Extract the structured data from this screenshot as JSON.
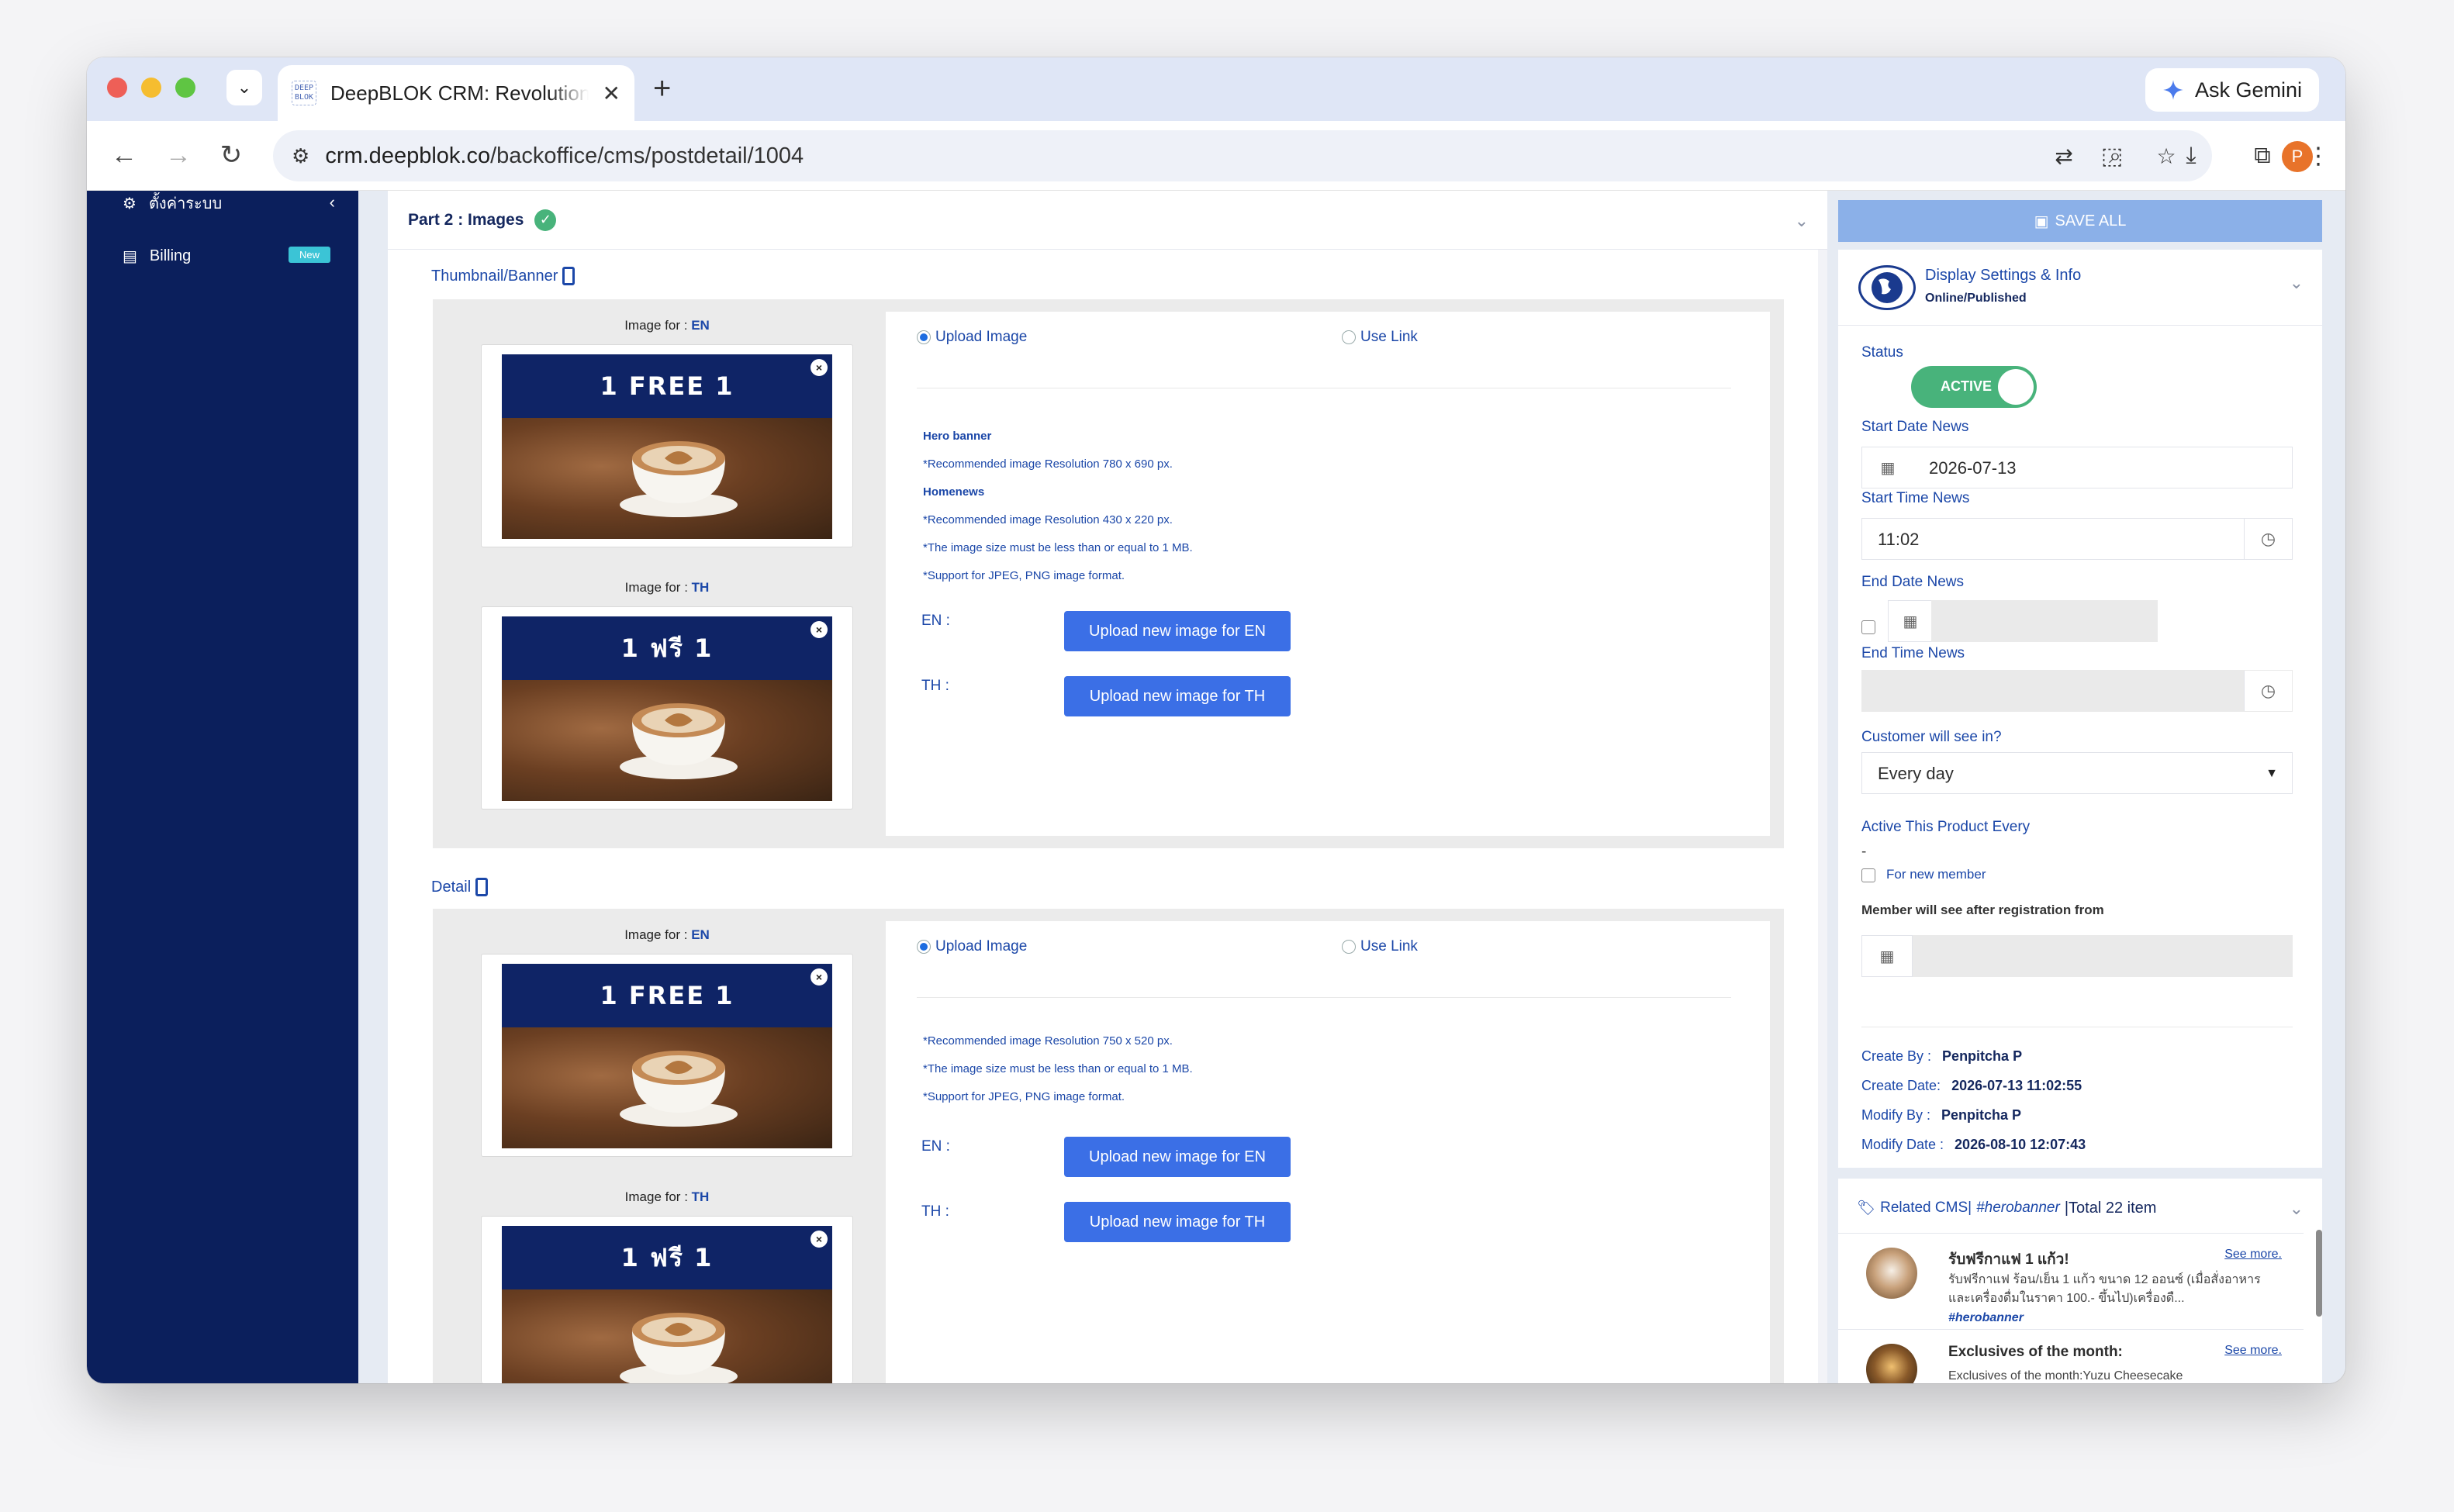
{
  "browser": {
    "tab_title": "DeepBLOK CRM: Revolutionize",
    "tab_favicon_text": "DEEP BLOK",
    "ask_gemini": "Ask Gemini",
    "url_host": "crm.deepblok.co",
    "url_path": "/backoffice/cms/postdetail/1004",
    "profile_initial": "P"
  },
  "sidebar": {
    "settings_label": "ตั้งค่าระบบ",
    "billing_label": "Billing",
    "billing_badge": "New"
  },
  "part2": {
    "title": "Part 2 : Images"
  },
  "thumbnail": {
    "section_label": "Thumbnail/Banner",
    "image_for_prefix": "Image for :",
    "lang_en": "EN",
    "lang_th": "TH",
    "banner_en_text": "1 FREE 1",
    "banner_th_text": "1 ฟรี 1",
    "radio_upload": "Upload Image",
    "radio_link": "Use Link",
    "hints": [
      "Hero banner",
      "*Recommended image Resolution 780 x 690 px.",
      "Homenews",
      "*Recommended image Resolution 430 x 220 px.",
      "*The image size must be less than or equal to 1 MB.",
      "*Support for JPEG, PNG image format."
    ],
    "en_label": "EN :",
    "th_label": "TH :",
    "btn_en": "Upload new image for EN",
    "btn_th": "Upload new image for TH"
  },
  "detail": {
    "section_label": "Detail",
    "image_for_prefix": "Image for :",
    "lang_en": "EN",
    "lang_th": "TH",
    "banner_en_text": "1 FREE 1",
    "banner_th_text": "1 ฟรี 1",
    "radio_upload": "Upload Image",
    "radio_link": "Use Link",
    "hints": [
      "*Recommended image Resolution 750 x 520 px.",
      "*The image size must be less than or equal to 1 MB.",
      "*Support for JPEG, PNG image format."
    ],
    "en_label": "EN :",
    "th_label": "TH :",
    "btn_en": "Upload new image for EN",
    "btn_th": "Upload new image for TH"
  },
  "right_panel": {
    "save_all": "SAVE ALL",
    "display_title": "Display Settings & Info",
    "display_status": "Online/Published",
    "status_label": "Status",
    "status_toggle": "ACTIVE",
    "start_date_label": "Start Date News",
    "start_date_value": "2026-07-13",
    "start_time_label": "Start Time News",
    "start_time_value": "11:02",
    "end_date_label": "End Date News",
    "end_time_label": "End Time News",
    "customer_see_label": "Customer will see in?",
    "customer_see_value": "Every day",
    "active_every_label": "Active This Product Every",
    "active_every_value": "-",
    "new_member_label": "For new member",
    "member_see_label": "Member will see after registration from",
    "create_by_label": "Create By :",
    "create_by_value": "Penpitcha P",
    "create_date_label": "Create Date:",
    "create_date_value": "2026-07-13 11:02:55",
    "modify_by_label": "Modify By :",
    "modify_by_value": "Penpitcha P",
    "modify_date_label": "Modify Date :",
    "modify_date_value": "2026-08-10 12:07:43"
  },
  "related": {
    "label": "Related CMS|",
    "tag": "#herobanner",
    "total": "|Total 22 item",
    "items": [
      {
        "title": "รับฟรีกาแฟ 1 แก้ว!",
        "more": "See more.",
        "desc": "รับฟรีกาแฟ ร้อน/เย็น 1 แก้ว ขนาด 12 ออนซ์ (เมื่อสั่งอาหารและเครื่องดื่มในราคา 100.- ขึ้นไป)เครื่องดื...",
        "tag": "#herobanner"
      },
      {
        "title": "Exclusives of the month:",
        "more": "See more.",
        "desc": "Exclusives of the month:Yuzu Cheesecake"
      }
    ]
  },
  "colors": {
    "sidebar_bg": "#0b1f5c",
    "accent_blue": "#3b6fe6",
    "link_blue": "#1b47a8",
    "active_green": "#48b37b",
    "save_all_bg": "#8bb0e8"
  }
}
